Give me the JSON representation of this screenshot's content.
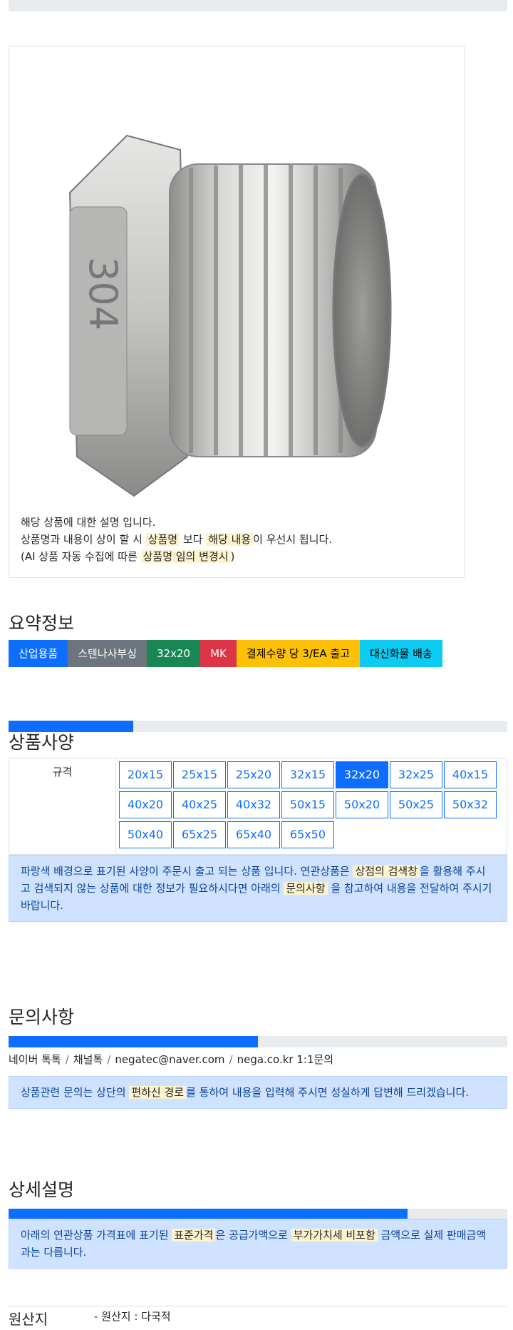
{
  "product": {
    "description_lines": [
      {
        "before": "해당 상품에 대한 설명 입니다.",
        "parts": []
      },
      {
        "parts": [
          {
            "text": "상품명과 내용이 상이 할 시 ",
            "hl": false
          },
          {
            "text": "상품명",
            "hl": true
          },
          {
            "text": " 보다 ",
            "hl": false
          },
          {
            "text": "해당 내용",
            "hl": true
          },
          {
            "text": "이 우선시 됩니다.",
            "hl": false
          }
        ]
      },
      {
        "parts": [
          {
            "text": "(AI 상품 자동 수집에 따른 ",
            "hl": false
          },
          {
            "text": "상품명 임의 변경시",
            "hl": true
          },
          {
            "text": ")",
            "hl": false
          }
        ]
      }
    ],
    "stamp_text": "304"
  },
  "summary": {
    "title": "요약정보",
    "badges": [
      {
        "label": "산업용품",
        "bg": "#0d6efd",
        "fg": "#ffffff"
      },
      {
        "label": "스텐나사부싱",
        "bg": "#6c757d",
        "fg": "#ffffff"
      },
      {
        "label": "32x20",
        "bg": "#198754",
        "fg": "#ffffff"
      },
      {
        "label": "MK",
        "bg": "#dc3545",
        "fg": "#ffffff"
      },
      {
        "label": "결제수량 당 3/EA 출고",
        "bg": "#ffc107",
        "fg": "#000000"
      },
      {
        "label": "대신화물 배송",
        "bg": "#0dcaf0",
        "fg": "#000000"
      }
    ]
  },
  "spec": {
    "title": "상품사양",
    "progress_pct": 25,
    "label": "규격",
    "options": [
      "20x15",
      "25x15",
      "25x20",
      "32x15",
      "32x20",
      "32x25",
      "40x15",
      "40x20",
      "40x25",
      "40x32",
      "50x15",
      "50x20",
      "50x25",
      "50x32",
      "50x40",
      "65x25",
      "65x40",
      "65x50"
    ],
    "selected": "32x20",
    "notice_parts": [
      {
        "text": "파랑색 배경으로 표기된 사양이 주문시 출고 되는 상품 입니다. 연관상품은 ",
        "hl": false
      },
      {
        "text": "상점의 검색창",
        "hl": true
      },
      {
        "text": "을 활용해 주시고 검색되지 않는 상품에 대한 정보가 필요하시다면 아래의 ",
        "hl": false
      },
      {
        "text": "문의사항",
        "hl": true
      },
      {
        "text": " 을 참고하여 내용을 전달하여 주시기 바랍니다.",
        "hl": false
      }
    ]
  },
  "inquiry": {
    "title": "문의사항",
    "progress_pct": 50,
    "channels": [
      "네이버 톡톡",
      "채널톡",
      "negatec@naver.com",
      "nega.co.kr 1:1문의"
    ],
    "notice_parts": [
      {
        "text": "상품관련 문의는 상단의 ",
        "hl": false
      },
      {
        "text": "편하신 경로",
        "hl": true
      },
      {
        "text": "를 통하여 내용을 입력해 주시면 성실하게 답변해 드리겠습니다.",
        "hl": false
      }
    ]
  },
  "detail": {
    "title": "상세설명",
    "progress_pct": 80,
    "notice_parts": [
      {
        "text": "아래의 연관상품 가격표에 표기된 ",
        "hl": false
      },
      {
        "text": "표준가격",
        "hl": true
      },
      {
        "text": "은 공급가액으로 ",
        "hl": false
      },
      {
        "text": "부가가치세 비포함",
        "hl": true
      },
      {
        "text": " 금액으로 실제 판매금액과는 다릅니다.",
        "hl": false
      }
    ]
  },
  "origin": {
    "label": "원산지",
    "value": "- 원산지 : 다국적"
  },
  "colors": {
    "primary": "#0d6efd",
    "highlight": "#fff3cd",
    "alert_bg": "#cfe2ff"
  }
}
